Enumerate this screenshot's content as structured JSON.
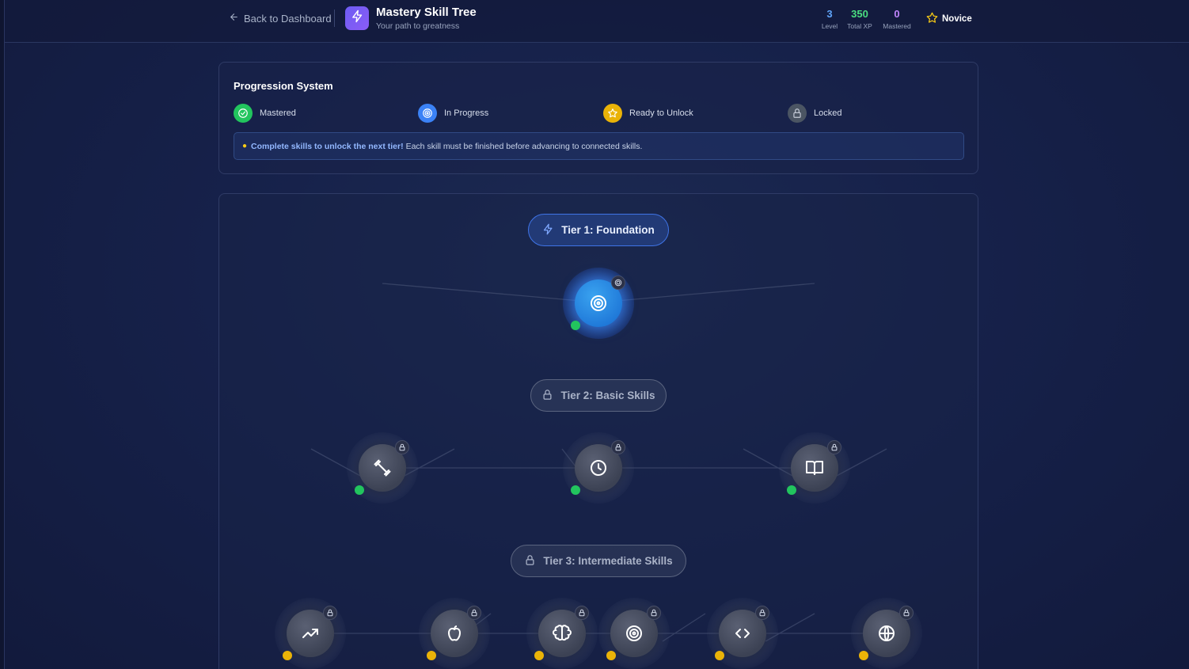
{
  "header": {
    "back_label": "Back to Dashboard",
    "app_title": "Mastery Skill Tree",
    "app_subtitle": "Your path to greatness",
    "stats": [
      {
        "value": "3",
        "label": "Level",
        "color": "#60a5fa"
      },
      {
        "value": "350",
        "label": "Total XP",
        "color": "#4ade80"
      },
      {
        "value": "0",
        "label": "Mastered",
        "color": "#c084fc"
      }
    ],
    "rank": "Novice"
  },
  "legend": {
    "title": "Progression System",
    "items": [
      {
        "label": "Mastered",
        "color": "#22c55e",
        "icon": "check-circle-icon"
      },
      {
        "label": "In Progress",
        "color": "#3b82f6",
        "icon": "target-icon"
      },
      {
        "label": "Ready to Unlock",
        "color": "#eab308",
        "icon": "star-icon"
      },
      {
        "label": "Locked",
        "color": "#4b5563",
        "icon": "lock-icon"
      }
    ],
    "tip_strong": "Complete skills to unlock the next tier!",
    "tip_text": "Each skill must be finished before advancing to connected skills."
  },
  "tiers": [
    {
      "label": "Tier 1: Foundation",
      "state": "active",
      "icon": "lightning-icon"
    },
    {
      "label": "Tier 2: Basic Skills",
      "state": "locked",
      "icon": "lock-icon"
    },
    {
      "label": "Tier 3: Intermediate Skills",
      "state": "locked",
      "icon": "lock-icon"
    }
  ],
  "skills": {
    "tier1": [
      {
        "icon": "target-icon",
        "state": "in-progress",
        "status": "green"
      }
    ],
    "tier2": [
      {
        "icon": "dumbbell-icon",
        "state": "locked",
        "status": "green"
      },
      {
        "icon": "clock-icon",
        "state": "locked",
        "status": "green"
      },
      {
        "icon": "book-icon",
        "state": "locked",
        "status": "green"
      }
    ],
    "tier3": [
      {
        "icon": "trending-up-icon",
        "state": "locked",
        "status": "yellow"
      },
      {
        "icon": "apple-icon",
        "state": "locked",
        "status": "yellow"
      },
      {
        "icon": "brain-icon",
        "state": "locked",
        "status": "yellow"
      },
      {
        "icon": "target-icon",
        "state": "locked",
        "status": "yellow"
      },
      {
        "icon": "code-icon",
        "state": "locked",
        "status": "yellow"
      },
      {
        "icon": "globe-icon",
        "state": "locked",
        "status": "yellow"
      }
    ]
  },
  "colors": {
    "background": "#16214a",
    "accent_blue": "#3b82f6",
    "mastered_green": "#22c55e",
    "ready_yellow": "#eab308",
    "locked_gray": "#4b5563"
  }
}
